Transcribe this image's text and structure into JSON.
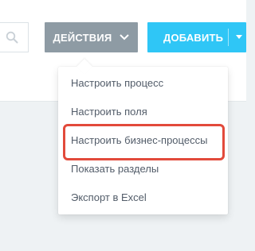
{
  "toolbar": {
    "actions_label": "ДЕЙСТВИЯ",
    "add_label": "ДОБАВИТЬ"
  },
  "icons": {
    "search": "search-icon",
    "actions_dropdown": "chevron-down-icon",
    "add_dropdown": "chevron-down-icon"
  },
  "menu": {
    "items": [
      {
        "label": "Настроить процесс"
      },
      {
        "label": "Настроить поля"
      },
      {
        "label": "Настроить бизнес-процессы"
      },
      {
        "label": "Показать разделы"
      },
      {
        "label": "Экспорт в Excel"
      }
    ]
  },
  "colors": {
    "actions_button": "#8e9ba4",
    "add_button": "#2fc6f6",
    "highlight": "#e24a3b",
    "menu_text": "#525c69",
    "background": "#eef2f4"
  }
}
